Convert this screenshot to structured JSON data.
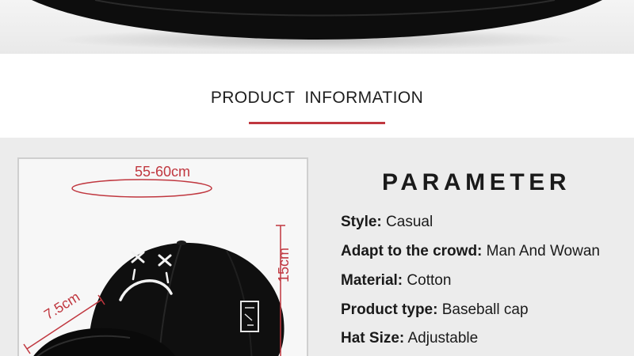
{
  "section": {
    "title": "PRODUCT INFORMATION"
  },
  "colors": {
    "accent": "#c0373f",
    "panel_background": "#ececec",
    "cap_color": "#0d0d0d"
  },
  "photo": {
    "circumference_label": "55-60cm",
    "brim_label": "7.5cm",
    "height_label": "15cm"
  },
  "parameters": {
    "heading": "PARAMETER",
    "rows": [
      {
        "key": "Style:",
        "value": "Casual"
      },
      {
        "key": "Adapt to the crowd:",
        "value": "Man And Wowan"
      },
      {
        "key": "Material:",
        "value": "Cotton"
      },
      {
        "key": "Product type:",
        "value": "Baseball cap"
      },
      {
        "key": "Hat Size:",
        "value": "Adjustable"
      }
    ]
  }
}
